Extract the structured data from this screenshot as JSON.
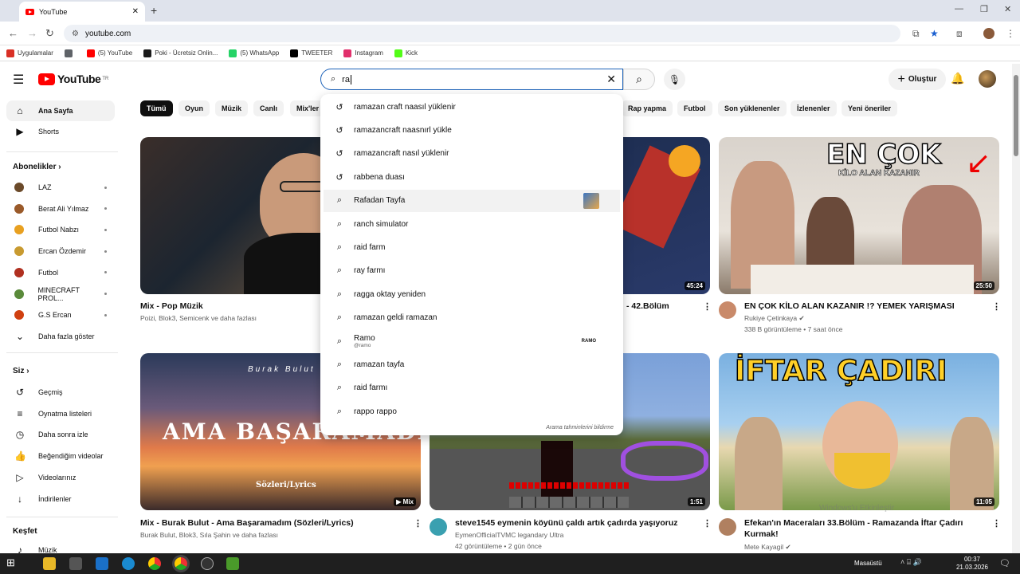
{
  "browser": {
    "tab_title": "YouTube",
    "url": "youtube.com",
    "bookmarks": [
      {
        "label": "Uygulamalar",
        "icon": "apps-icon",
        "color": "#d93025"
      },
      {
        "label": "",
        "icon": "grid-icon",
        "color": "#5f6368"
      },
      {
        "label": "(5) YouTube",
        "icon": "youtube-icon",
        "color": "#ff0000"
      },
      {
        "label": "Poki - Ücretsiz Onlin...",
        "icon": "poki-icon",
        "color": "#1a1a1a"
      },
      {
        "label": "(5) WhatsApp",
        "icon": "whatsapp-icon",
        "color": "#25d366"
      },
      {
        "label": "TWEETER",
        "icon": "x-icon",
        "color": "#000000"
      },
      {
        "label": "Instagram",
        "icon": "instagram-icon",
        "color": "#e1306c"
      },
      {
        "label": "Kick",
        "icon": "kick-icon",
        "color": "#53fc18"
      }
    ]
  },
  "header": {
    "logo_text": "YouTube",
    "logo_sup": "TR",
    "search_value": "ra",
    "create_label": "Oluştur"
  },
  "sidebar": {
    "main": [
      {
        "label": "Ana Sayfa",
        "icon": "home-icon"
      },
      {
        "label": "Shorts",
        "icon": "shorts-icon"
      }
    ],
    "subs_heading": "Abonelikler",
    "subs": [
      {
        "label": "LAZ",
        "color": "#6b4a2a"
      },
      {
        "label": "Berat Ali Yılmaz",
        "color": "#9a5a2a"
      },
      {
        "label": "Futbol Nabzı",
        "color": "#e8a020"
      },
      {
        "label": "Ercan Özdemir",
        "color": "#c89a30"
      },
      {
        "label": "Futbol",
        "color": "#b03020"
      },
      {
        "label": "MINECRAFT PROL...",
        "color": "#5a8a3a"
      },
      {
        "label": "G.S Ercan",
        "color": "#d04010"
      }
    ],
    "more_label": "Daha fazla göster",
    "you_heading": "Siz",
    "you_items": [
      {
        "label": "Geçmiş",
        "icon": "history-icon"
      },
      {
        "label": "Oynatma listeleri",
        "icon": "playlist-icon"
      },
      {
        "label": "Daha sonra izle",
        "icon": "clock-icon"
      },
      {
        "label": "Beğendiğim videolar",
        "icon": "thumbs-up-icon"
      },
      {
        "label": "Videolarınız",
        "icon": "video-icon"
      },
      {
        "label": "İndirilenler",
        "icon": "download-icon"
      }
    ],
    "explore_heading": "Keşfet",
    "explore_items": [
      {
        "label": "Müzik",
        "icon": "music-icon"
      }
    ]
  },
  "chips": [
    "Tümü",
    "Oyun",
    "Müzik",
    "Canlı",
    "Mix'ler",
    "Rap yapma",
    "Futbol",
    "Son yüklenenler",
    "İzlenenler",
    "Yeni öneriler"
  ],
  "suggestions": [
    {
      "text": "ramazan craft naasıl yüklenir",
      "type": "history"
    },
    {
      "text": "ramazancraft naasnırl yükle",
      "type": "history"
    },
    {
      "text": "ramazancraft nasıl yüklenir",
      "type": "history"
    },
    {
      "text": "rabbena duası",
      "type": "history"
    },
    {
      "text": "Rafadan Tayfa",
      "type": "search"
    },
    {
      "text": "ranch simulator",
      "type": "search"
    },
    {
      "text": "raid farm",
      "type": "search"
    },
    {
      "text": "ray farmı",
      "type": "search"
    },
    {
      "text": "ragga oktay yeniden",
      "type": "search"
    },
    {
      "text": "ramazan geldi ramazan",
      "type": "search"
    },
    {
      "text": "Ramo",
      "sub": "@ramo",
      "type": "channel",
      "badge": "RAMO"
    },
    {
      "text": "ramazan tayfa",
      "type": "search"
    },
    {
      "text": "raid farmı",
      "type": "search"
    },
    {
      "text": "rappo rappo",
      "type": "search"
    }
  ],
  "report_label": "Arama tahminlerini bildirme",
  "videos": [
    {
      "title": "Mix - Pop Müzik",
      "meta1": "Poizi, Blok3, Semicenk ve daha fazlası",
      "meta2": "",
      "duration": ""
    },
    {
      "title": "- 42.Bölüm",
      "meta1": "",
      "meta2": "",
      "duration": "45:24"
    },
    {
      "title": "EN ÇOK KİLO ALAN KAZANIR !? YEMEK YARIŞMASI",
      "meta1": "Rukiye Çetinkaya",
      "meta2": "338 B görüntüleme • 7 saat önce",
      "duration": "25:50",
      "thumb_text1": "EN ÇOK",
      "thumb_text2": "KİLO ALAN KAZANIR"
    },
    {
      "title": "Mix - Burak Bulut - Ama Başaramadım (Sözleri/Lyrics)",
      "meta1": "Burak Bulut, Blok3, Sıla Şahin ve daha fazlası",
      "meta2": "",
      "duration": "Mix",
      "thumb_text1": "Burak Bulut",
      "thumb_text2": "AMA BAŞARAMADIM",
      "thumb_text3": "Sözleri/Lyrics"
    },
    {
      "title": "steve1545 eymenin köyünü çaldı artık çadırda yaşıyoruz",
      "meta1": "EymenOfficialTVMC legandary Ultra",
      "meta2": "42 görüntüleme • 2 gün önce",
      "duration": "1:51"
    },
    {
      "title": "Efekan'ın Maceraları 33.Bölüm - Ramazanda İftar Çadırı",
      "title2": "Kurmak!",
      "meta1": "Mete Kayagil",
      "meta2": "",
      "duration": "11:05",
      "thumb_text1": "İFTAR ÇADIRI"
    }
  ],
  "taskbar": {
    "desk_label": "Masaüstü",
    "time": "00:37",
    "date": "21.03.2026"
  },
  "watermark": "Windows'u Etkinleştir"
}
